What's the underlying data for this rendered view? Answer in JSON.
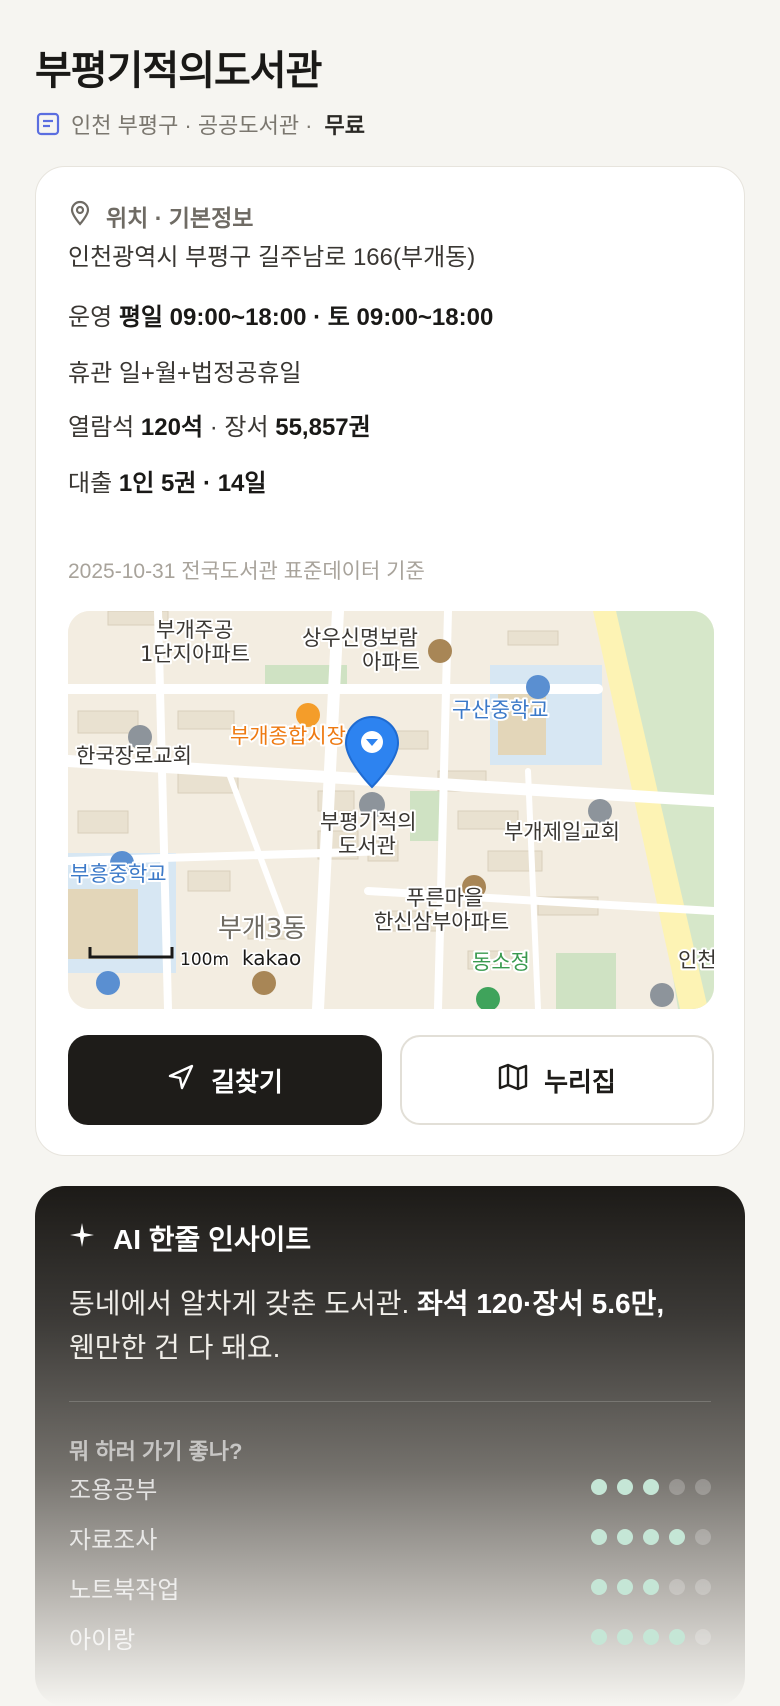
{
  "title": "부평기적의도서관",
  "meta": {
    "region_type": "인천 부평구 · 공공도서관 ·",
    "fee": "무료"
  },
  "info": {
    "section_title": "위치 · 기본정보",
    "address": "인천광역시 부평구 길주남로 166(부개동)",
    "hours_label": "운영",
    "hours_value": "평일 09:00~18:00 · 토 09:00~18:00",
    "closed_label": "휴관",
    "closed_value": "일+월+법정공휴일",
    "seats_label": "열람석",
    "seats_value": "120석",
    "sep": "·",
    "books_label": "장서",
    "books_value": "55,857권",
    "loan_label": "대출",
    "loan_value": "1인 5권 · 14일",
    "source": "2025-10-31 전국도서관 표준데이터 기준"
  },
  "map": {
    "labels": {
      "apt1_l1": "부개주공",
      "apt1_l2": "1단지아파트",
      "apt2_l1": "상우신명보람",
      "apt2_l2": "아파트",
      "school1": "구산중학교",
      "market": "부개종합시장",
      "church1": "한국장로교회",
      "library_l1": "부평기적의",
      "library_l2": "도서관",
      "church2": "부개제일교회",
      "school2": "부흥중학교",
      "apt3_l1": "푸른마을",
      "apt3_l2": "한신삼부아파트",
      "dong": "부개3동",
      "park": "동소정",
      "edge": "인천",
      "scale": "100m",
      "brand": "kakao"
    }
  },
  "buttons": {
    "directions": "길찾기",
    "website": "누리집"
  },
  "ai": {
    "title": "AI 한줄 인사이트",
    "text_plain": "동네에서 알차게 갖춘 도서관.",
    "text_bold": "좌석 120·장서 5.6만,",
    "text_plain2": "웬만한 건 다 돼요.",
    "question": "뭐 하러 가기 좋나?",
    "activities": [
      {
        "label": "조용공부",
        "score": 3
      },
      {
        "label": "자료조사",
        "score": 4
      },
      {
        "label": "노트북작업",
        "score": 3
      },
      {
        "label": "아이랑",
        "score": 4
      }
    ],
    "max_score": 5
  }
}
